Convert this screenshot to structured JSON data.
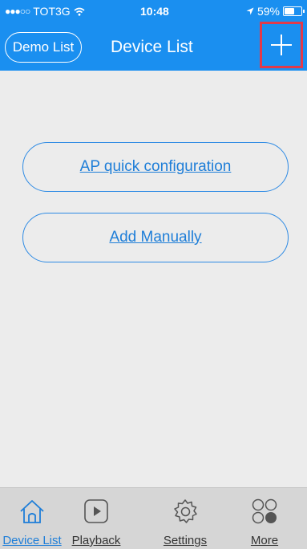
{
  "status_bar": {
    "signal": "●●●○○",
    "carrier": "TOT3G",
    "time": "10:48",
    "battery_text": "59%",
    "battery_level": 0.59
  },
  "nav": {
    "left_button": "Demo List",
    "title": "Device List",
    "add_icon": "plus-icon"
  },
  "actions": {
    "ap_config": "AP quick configuration",
    "add_manually": "Add Manually"
  },
  "tabs": [
    {
      "label": "Device List",
      "icon": "home-icon",
      "active": true
    },
    {
      "label": "Playback",
      "icon": "play-icon",
      "active": false
    },
    {
      "label": "Settings",
      "icon": "gear-icon",
      "active": false
    },
    {
      "label": "More",
      "icon": "more-icon",
      "active": false
    }
  ],
  "colors": {
    "header": "#1a8ff0",
    "accent": "#1e7ed8",
    "highlight": "#e23a4a",
    "background": "#ececec",
    "tabbar": "#d6d6d6"
  }
}
